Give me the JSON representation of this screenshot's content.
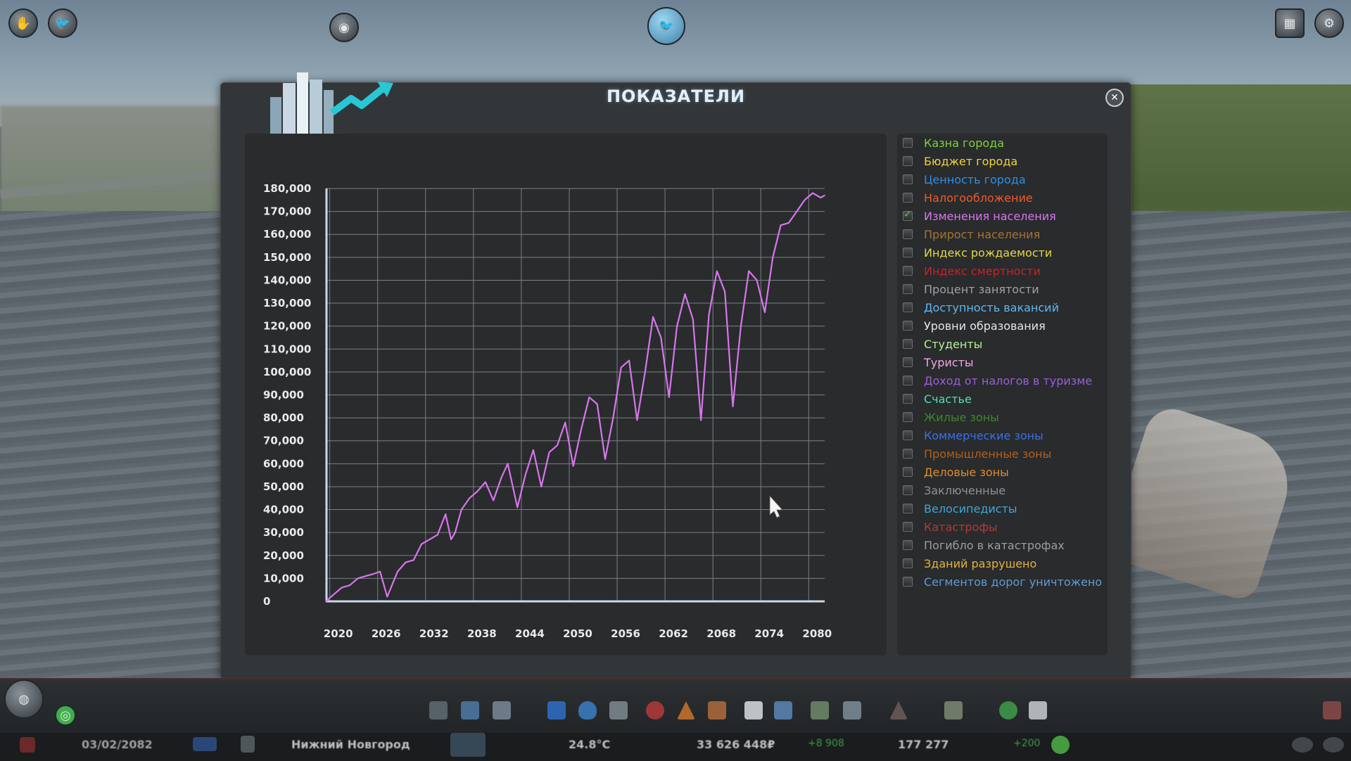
{
  "window": {
    "title": "ПОКАЗАТЕЛИ",
    "close_icon": "close-icon"
  },
  "top_icons": [
    "unlock-icon",
    "bird-icon",
    "radio-icon",
    "chirper-icon",
    "info-view-icon",
    "gear-icon"
  ],
  "legend": [
    {
      "label": "Казна города",
      "color": "#7dd33b",
      "checked": false
    },
    {
      "label": "Бюджет города",
      "color": "#f2d43a",
      "checked": false
    },
    {
      "label": "Ценность города",
      "color": "#2f8fe8",
      "checked": false
    },
    {
      "label": "Налогообложение",
      "color": "#f05a2a",
      "checked": false
    },
    {
      "label": "Изменения населения",
      "color": "#d776ec",
      "checked": true
    },
    {
      "label": "Прирост населения",
      "color": "#a8742f",
      "checked": false
    },
    {
      "label": "Индекс рождаемости",
      "color": "#e2d84a",
      "checked": false
    },
    {
      "label": "Индекс смертности",
      "color": "#c2262a",
      "checked": false
    },
    {
      "label": "Процент занятости",
      "color": "#9ea3a7",
      "checked": false
    },
    {
      "label": "Доступность вакансий",
      "color": "#5fb8f3",
      "checked": false
    },
    {
      "label": "Уровни образования",
      "color": "#e6e6e6",
      "checked": false
    },
    {
      "label": "Студенты",
      "color": "#b9f08f",
      "checked": false
    },
    {
      "label": "Туристы",
      "color": "#f4a6ec",
      "checked": false
    },
    {
      "label": "Доход от налогов в туризме",
      "color": "#9b5fd8",
      "checked": false
    },
    {
      "label": "Счастье",
      "color": "#4fe0b1",
      "checked": false
    },
    {
      "label": "Жилые зоны",
      "color": "#3a8a2c",
      "checked": false
    },
    {
      "label": "Коммерческие зоны",
      "color": "#3b70e6",
      "checked": false
    },
    {
      "label": "Промышленные зоны",
      "color": "#b1601e",
      "checked": false
    },
    {
      "label": "Деловые зоны",
      "color": "#e08b2c",
      "checked": false
    },
    {
      "label": "Заключенные",
      "color": "#8e9397",
      "checked": false
    },
    {
      "label": "Велосипедисты",
      "color": "#3fa8d6",
      "checked": false
    },
    {
      "label": "Катастрофы",
      "color": "#b23a3a",
      "checked": false
    },
    {
      "label": "Погибло в катастрофах",
      "color": "#9b9fa3",
      "checked": false
    },
    {
      "label": "Зданий разрушено",
      "color": "#e1b43d",
      "checked": false
    },
    {
      "label": "Сегментов дорог уничтожено",
      "color": "#5e9bd2",
      "checked": false
    }
  ],
  "chart_data": {
    "type": "line",
    "title": "",
    "xlabel": "",
    "ylabel": "",
    "ylim": [
      0,
      180000
    ],
    "xlim": [
      2019.5,
      2082
    ],
    "grid": true,
    "x_ticks": [
      "2020",
      "2026",
      "2032",
      "2038",
      "2044",
      "2050",
      "2056",
      "2062",
      "2068",
      "2074",
      "2080"
    ],
    "y_ticks": [
      "0",
      "10,000",
      "20,000",
      "30,000",
      "40,000",
      "50,000",
      "60,000",
      "70,000",
      "80,000",
      "90,000",
      "100,000",
      "110,000",
      "120,000",
      "130,000",
      "140,000",
      "150,000",
      "160,000",
      "170,000",
      "180,000"
    ],
    "series": [
      {
        "color": "#d776ec",
        "x": [
          2019.5,
          2020.5,
          2021.5,
          2022.5,
          2023.5,
          2024.5,
          2025.5,
          2026.3,
          2027.2,
          2028.5,
          2029.5,
          2030.5,
          2031.5,
          2032.5,
          2033.5,
          2034.5,
          2035.2,
          2035.7,
          2036.5,
          2037.5,
          2038.5,
          2039.5,
          2040.5,
          2041.5,
          2042.3,
          2043.5,
          2044.5,
          2045.5,
          2046.5,
          2047.5,
          2048.5,
          2049.5,
          2050.5,
          2051.5,
          2052.5,
          2053.5,
          2054.5,
          2055.5,
          2056.5,
          2057.5,
          2058.5,
          2059.5,
          2060.5,
          2061.5,
          2062.5,
          2063.5,
          2064.5,
          2065.5,
          2066.5,
          2067.5,
          2068.5,
          2069.5,
          2070.5,
          2071.5,
          2072.5,
          2073.5,
          2074.5,
          2075.5,
          2076.5,
          2077.5,
          2078.5,
          2079.5,
          2080.5,
          2081.5,
          2082.0
        ],
        "y": [
          0,
          3000,
          6000,
          7000,
          10000,
          11000,
          12000,
          13000,
          2000,
          13000,
          17000,
          18000,
          25000,
          27000,
          29000,
          38000,
          27000,
          30000,
          40000,
          45000,
          48000,
          52000,
          44000,
          54000,
          60000,
          41000,
          55000,
          66000,
          50000,
          65000,
          68000,
          78000,
          59000,
          75000,
          89000,
          86000,
          62000,
          80000,
          102000,
          105000,
          79000,
          100000,
          124000,
          115000,
          89000,
          120000,
          134000,
          123000,
          79000,
          125000,
          144000,
          135000,
          85000,
          120000,
          144000,
          140000,
          126000,
          150000,
          164000,
          165000,
          170000,
          175000,
          178000,
          176000,
          177000
        ]
      }
    ]
  },
  "bottombar": {
    "date": "03/02/2082",
    "city_name": "Нижний Новгород",
    "temperature": "24.8°C",
    "money": "33 626 448₽",
    "money_delta": "+8 908",
    "population": "177 277",
    "population_delta": "+200"
  }
}
